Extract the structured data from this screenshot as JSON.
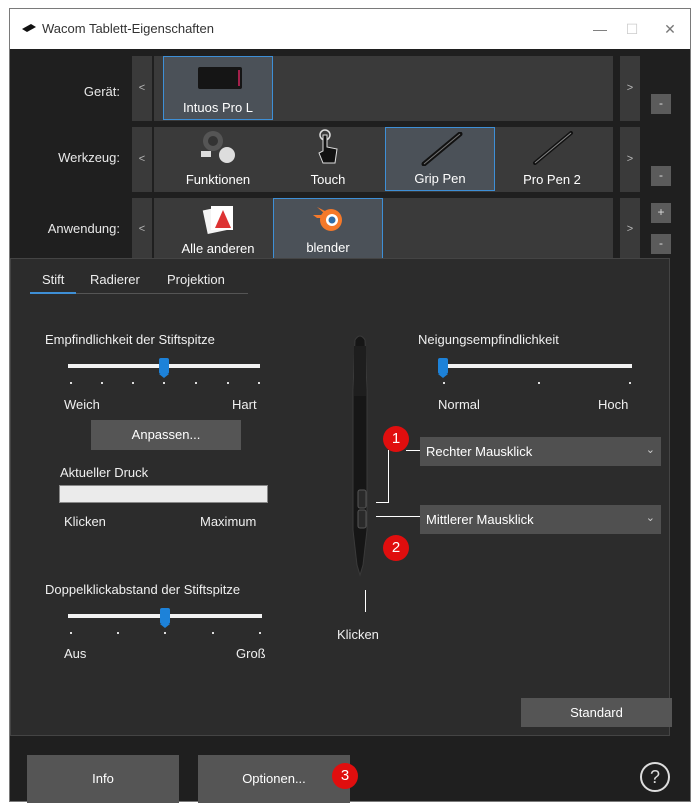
{
  "window": {
    "title": "Wacom Tablett-Eigenschaften",
    "minimize": "—",
    "maximize": "☐",
    "close": "✕"
  },
  "rows": {
    "device": {
      "label": "Gerät:",
      "tiles": [
        "Intuos Pro L"
      ],
      "selected": 0,
      "minus": "-"
    },
    "tool": {
      "label": "Werkzeug:",
      "tiles": [
        "Funktionen",
        "Touch",
        "Grip Pen",
        "Pro Pen 2"
      ],
      "selected": 2,
      "minus": "-"
    },
    "app": {
      "label": "Anwendung:",
      "tiles": [
        "Alle anderen",
        "blender"
      ],
      "selected": 1,
      "plus": "+",
      "minus": "-"
    },
    "arrow_left": "<",
    "arrow_right": ">"
  },
  "tabs": [
    "Stift",
    "Radierer",
    "Projektion"
  ],
  "active_tab": 0,
  "tip_sensitivity": {
    "title": "Empfindlichkeit der Stiftspitze",
    "min_label": "Weich",
    "max_label": "Hart",
    "value": 0.5,
    "customize": "Anpassen..."
  },
  "pressure": {
    "title": "Aktueller Druck",
    "min_label": "Klicken",
    "max_label": "Maximum"
  },
  "double_click": {
    "title": "Doppelklickabstand der Stiftspitze",
    "min_label": "Aus",
    "max_label": "Groß",
    "value": 0.5
  },
  "tilt": {
    "title": "Neigungsempfindlichkeit",
    "min_label": "Normal",
    "max_label": "Hoch",
    "value": 0.0
  },
  "pen_buttons": {
    "upper": "Rechter Mausklick",
    "lower": "Mittlerer Mausklick",
    "tip": "Klicken",
    "chevron": "⌄"
  },
  "badges": [
    "1",
    "2",
    "3"
  ],
  "buttons": {
    "default": "Standard",
    "info": "Info",
    "options": "Optionen...",
    "help": "?"
  },
  "colors": {
    "accent": "#3e8fd6",
    "badge": "#e00e0e",
    "panel": "#2c2c2c"
  }
}
